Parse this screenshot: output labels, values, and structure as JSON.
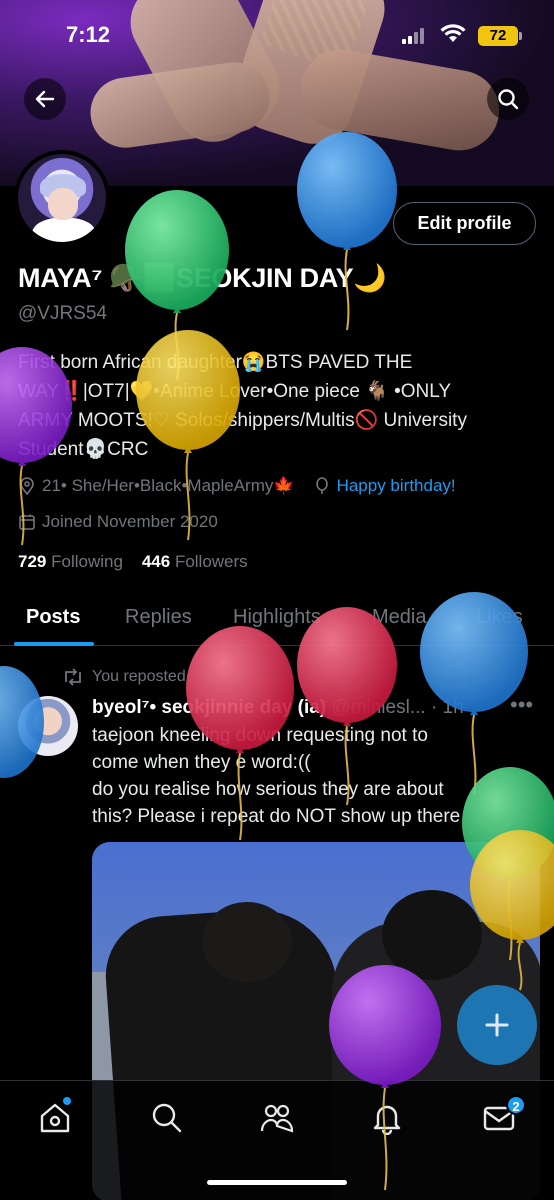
{
  "status_bar": {
    "time": "7:12",
    "battery": "72"
  },
  "profile": {
    "display_name": "MAYA⁷ 🪖🟩SEOKJIN DAY🌙",
    "handle": "@VJRS54",
    "bio_lines": [
      "First born African daughter😭BTS PAVED THE",
      "WAY‼️|OT7|💛•Anime Lover•One piece 🐐 •ONLY",
      "ARMY MOOTS!♡ Solos/shippers/Multis🚫 University",
      "Student💀CRC"
    ],
    "location": "21• She/Her•Black•MapleArmy🍁",
    "birthday_link": "Happy birthday!",
    "joined": "Joined November 2020",
    "following_count": "729",
    "following_label": "Following",
    "followers_count": "446",
    "followers_label": "Followers",
    "edit_button": "Edit profile"
  },
  "tabs": [
    "Posts",
    "Replies",
    "Highlights",
    "Media",
    "Likes"
  ],
  "post": {
    "repost_label": "You reposted",
    "author_name": "byeol⁷• seokjinnie day (ia)",
    "author_handle": "@miniesl...",
    "time": "· 1h",
    "text_lines": [
      "taejoon kneeling down requesting not to",
      "come when they e word:((",
      "do you realise how serious they are about",
      "this? Please i repeat do NOT show up there"
    ]
  },
  "nav": {
    "items": [
      "home-icon",
      "search-icon",
      "communities-icon",
      "notifications-icon",
      "messages-icon"
    ],
    "messages_badge": "2"
  },
  "colors": {
    "accent": "#1d9bf0",
    "battery": "#f1c40f",
    "balloon_green": "#2ecc71",
    "balloon_blue": "#3498db",
    "balloon_yellow": "#f1c40f",
    "balloon_purple": "#9b30d9",
    "balloon_red": "#e03a5c"
  }
}
